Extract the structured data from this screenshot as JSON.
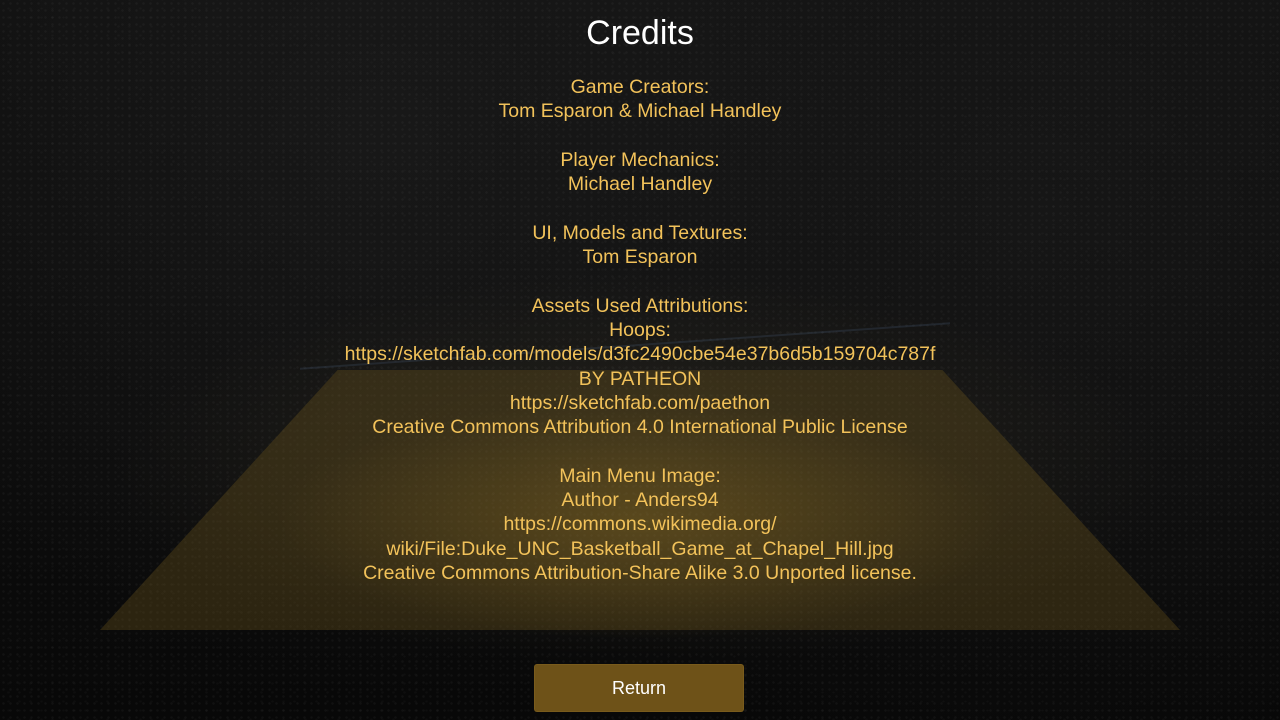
{
  "screen": {
    "title": "Credits"
  },
  "sections": [
    {
      "heading": "Game Creators:",
      "lines": [
        "Tom Esparon & Michael Handley"
      ]
    },
    {
      "heading": "Player Mechanics:",
      "lines": [
        "Michael Handley"
      ]
    },
    {
      "heading": "UI, Models and Textures:",
      "lines": [
        "Tom Esparon"
      ]
    },
    {
      "heading": "Assets Used Attributions:",
      "lines": [
        "Hoops:",
        "https://sketchfab.com/models/d3fc2490cbe54e37b6d5b159704c787f",
        "BY PATHEON",
        "https://sketchfab.com/paethon",
        "Creative Commons Attribution 4.0 International Public License"
      ]
    },
    {
      "heading": "Main Menu Image:",
      "lines": [
        "Author - Anders94",
        "https://commons.wikimedia.org/",
        "wiki/File:Duke_UNC_Basketball_Game_at_Chapel_Hill.jpg",
        "Creative Commons Attribution-Share Alike 3.0 Unported license."
      ]
    }
  ],
  "buttons": {
    "return_label": "Return"
  },
  "colors": {
    "credit_text": "#f2c25a",
    "title_text": "#ffffff",
    "button_bg": "#6e5218"
  }
}
